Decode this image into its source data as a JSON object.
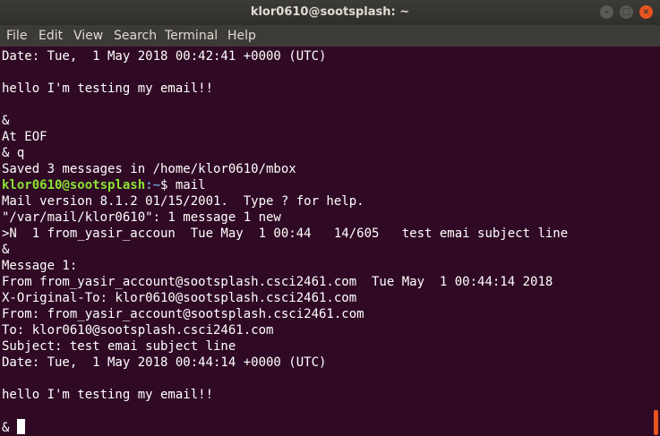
{
  "window": {
    "title": "klor0610@sootsplash: ~"
  },
  "menu": {
    "file": "File",
    "edit": "Edit",
    "view": "View",
    "search": "Search",
    "terminal": "Terminal",
    "help": "Help"
  },
  "terminal": {
    "lines": [
      "Date: Tue,  1 May 2018 00:42:41 +0000 (UTC)",
      "",
      "hello I'm testing my email!!",
      "",
      "&",
      "At EOF",
      "& q",
      "Saved 3 messages in /home/klor0610/mbox",
      "",
      "Mail version 8.1.2 01/15/2001.  Type ? for help.",
      "\"/var/mail/klor0610\": 1 message 1 new",
      ">N  1 from_yasir_accoun  Tue May  1 00:44   14/605   test emai subject line",
      "&",
      "Message 1:",
      "From from_yasir_account@sootsplash.csci2461.com  Tue May  1 00:44:14 2018",
      "X-Original-To: klor0610@sootsplash.csci2461.com",
      "From: from_yasir_account@sootsplash.csci2461.com",
      "To: klor0610@sootsplash.csci2461.com",
      "Subject: test emai subject line",
      "Date: Tue,  1 May 2018 00:44:14 +0000 (UTC)",
      "",
      "hello I'm testing my email!!",
      "",
      "& "
    ],
    "prompt": {
      "user_host": "klor0610@sootsplash",
      "path": ":~",
      "symbol": "$ ",
      "command": "mail"
    }
  },
  "colors": {
    "background": "#300a24",
    "prompt_user": "#8ae234",
    "prompt_path": "#729fcf",
    "accent": "#e95420"
  }
}
